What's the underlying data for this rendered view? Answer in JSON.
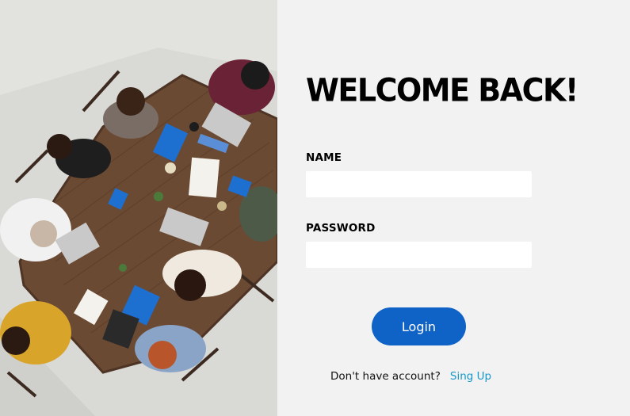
{
  "form": {
    "title": "WELCOME BACK!",
    "name_label": "NAME",
    "name_value": "",
    "password_label": "PASSWORD",
    "password_value": "",
    "login_label": "Login",
    "no_account_text": "Don't have account?",
    "signup_link": "Sing Up"
  },
  "colors": {
    "background": "#f2f2f2",
    "button": "#0f62c6",
    "link": "#1598c9"
  }
}
